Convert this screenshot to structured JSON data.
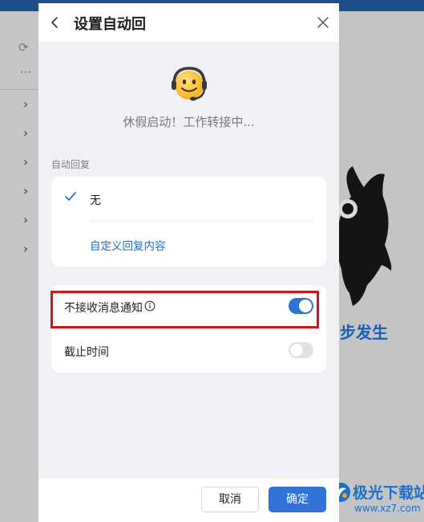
{
  "dialog": {
    "title": "设置自动回",
    "status_text": "休假启动！工作转接中...",
    "reply_section_label": "自动回复",
    "reply_option_selected": "无",
    "custom_reply_link": "自定义回复内容",
    "settings": [
      {
        "label": "不接收消息通知",
        "enabled": true
      },
      {
        "label": "截止时间",
        "enabled": false
      }
    ],
    "footer": {
      "cancel_label": "取消",
      "confirm_label": "确定"
    }
  },
  "background": {
    "brand_text": "步发生",
    "watermark_title": "极光下载站",
    "watermark_url": "www.xz7.com"
  },
  "icons": {
    "back": "chevron-left-icon",
    "close": "close-icon",
    "check": "check-icon",
    "info": "info-icon",
    "emoji": "headset-smiley-icon",
    "refresh": "refresh-icon",
    "more": "more-icon",
    "expand": "chevron-right-icon"
  },
  "colors": {
    "accent": "#2f72d8",
    "link": "#1c6fc3",
    "highlight_border": "#d0141b"
  }
}
